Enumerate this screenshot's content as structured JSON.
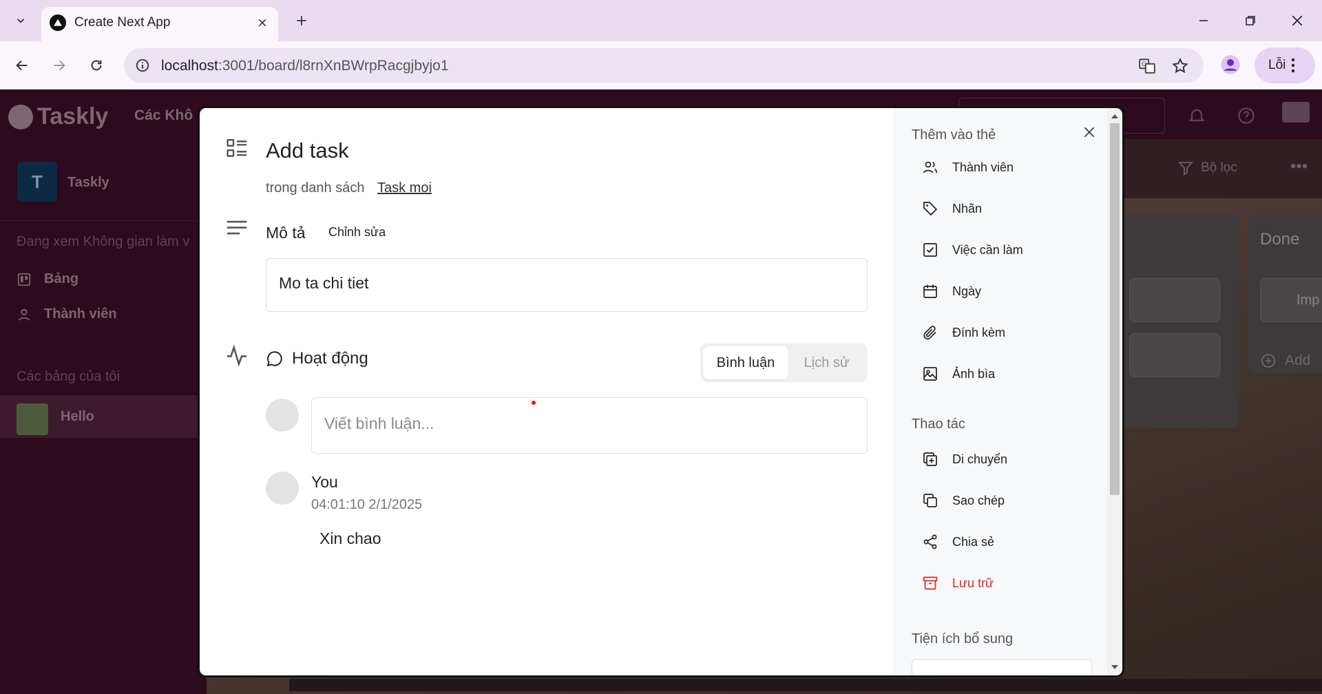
{
  "browser": {
    "tab_title": "Create Next App",
    "url_host": "localhost",
    "url_rest": ":3001/board/l8rnXnBWrpRacgjbyjo1",
    "error_label": "Lỗi"
  },
  "app": {
    "brand": "Taskly",
    "header_nav": "Các Khô",
    "workspace_initial": "T",
    "workspace_name": "Taskly",
    "sidebar_note": "Đang xem Không gian làm v",
    "sidebar_items": [
      {
        "label": "Bảng"
      },
      {
        "label": "Thành viên"
      }
    ],
    "boards_heading": "Các bảng của tôi",
    "board_name": "Hello",
    "filter_label": "Bộ lọc",
    "list_done_title": "Done",
    "list_card_fragment": "Imp",
    "add_card_fragment": "Add"
  },
  "modal": {
    "title": "Add task",
    "in_list_prefix": "trong danh sách",
    "list_name": "Task moi",
    "description_label": "Mô tả",
    "edit_label": "Chỉnh sửa",
    "description_text": "Mo ta chi tiet",
    "activity_label": "Hoạt động",
    "tab_comments": "Bình luận",
    "tab_history": "Lịch sử",
    "comment_placeholder": "Viết bình luận...",
    "comment": {
      "author": "You",
      "time": "04:01:10 2/1/2025",
      "text": "Xin chao"
    }
  },
  "side_panel": {
    "add_to_card_heading": "Thêm vào thẻ",
    "add_items": [
      {
        "label": "Thành viên",
        "icon": "users-icon"
      },
      {
        "label": "Nhãn",
        "icon": "tag-icon"
      },
      {
        "label": "Việc cần làm",
        "icon": "checkbox-icon"
      },
      {
        "label": "Ngày",
        "icon": "calendar-icon"
      },
      {
        "label": "Đính kèm",
        "icon": "paperclip-icon"
      },
      {
        "label": "Ảnh bìa",
        "icon": "image-icon"
      }
    ],
    "actions_heading": "Thao tác",
    "action_items": [
      {
        "label": "Di chuyển",
        "icon": "move-icon"
      },
      {
        "label": "Sao chép",
        "icon": "copy-icon"
      },
      {
        "label": "Chia sẻ",
        "icon": "share-icon"
      },
      {
        "label": "Lưu trữ",
        "icon": "archive-icon",
        "color": "#e02424"
      }
    ],
    "extras_heading": "Tiện ích bổ sung"
  }
}
